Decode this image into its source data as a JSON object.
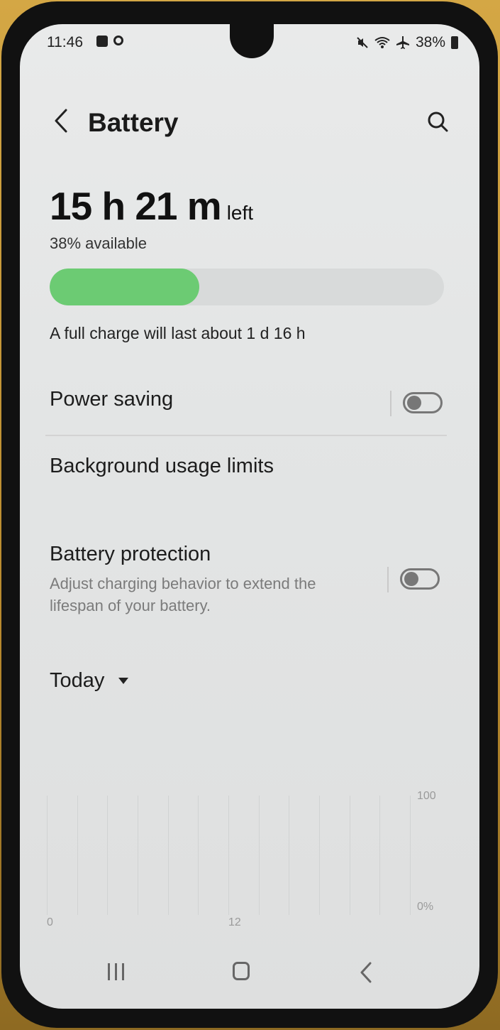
{
  "status_bar": {
    "time": "11:46",
    "battery_percent": "38%",
    "icons": [
      "checkbox-notification-icon",
      "app-notification-icon",
      "mute-icon",
      "wifi-icon",
      "airplane-icon",
      "battery-icon"
    ]
  },
  "header": {
    "title": "Battery",
    "back_icon": "chevron-left-icon",
    "search_icon": "search-icon"
  },
  "summary": {
    "time_left": "15 h 21 m",
    "time_left_suffix": "left",
    "available": "38% available",
    "level_percent": 38,
    "full_charge": "A full charge will last about 1 d 16 h",
    "bar_color": "#6ccb73"
  },
  "settings": {
    "power_saving": {
      "label": "Power saving",
      "enabled": false
    },
    "background_limits": {
      "label": "Background usage limits"
    },
    "battery_protection": {
      "label": "Battery protection",
      "description": "Adjust charging behavior to extend the lifespan of your battery.",
      "enabled": false
    }
  },
  "period": {
    "selected": "Today"
  },
  "chart_data": {
    "type": "line",
    "x_ticks": [
      "0",
      "12"
    ],
    "y_ticks": [
      "100",
      "0%"
    ],
    "ylim": [
      0,
      100
    ],
    "grid": true,
    "series": []
  },
  "nav": {
    "recents_icon": "recents-icon",
    "home_icon": "home-icon",
    "back_icon": "back-icon"
  }
}
